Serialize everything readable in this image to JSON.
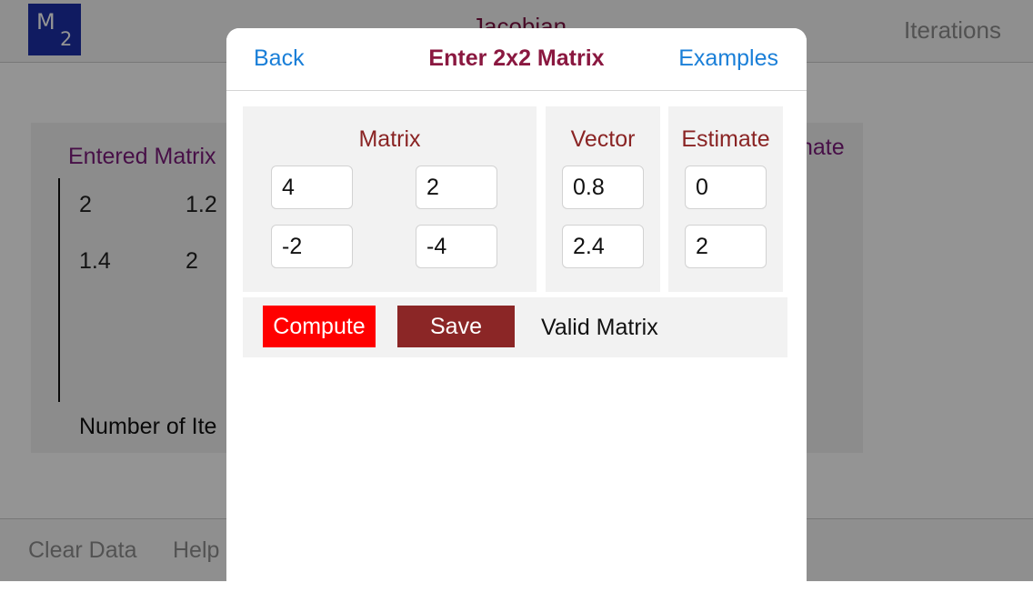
{
  "background": {
    "logo": {
      "letter": "M",
      "subscript": "2"
    },
    "title": "Jacobian",
    "nav_right": "Iterations",
    "panel": {
      "entered_label": "Entered Matrix",
      "estimate_label_partial": "nate",
      "cells": [
        [
          "2",
          "1.2"
        ],
        [
          "1.4",
          "2"
        ]
      ],
      "iterations_label_partial": "Number of Ite"
    },
    "bottom_bar": {
      "clear_label": "Clear Data",
      "help_label_partial": "Help"
    }
  },
  "modal": {
    "back_label": "Back",
    "title": "Enter 2x2 Matrix",
    "examples_label": "Examples",
    "matrix_label": "Matrix",
    "vector_label": "Vector",
    "estimate_label": "Estimate",
    "matrix": [
      [
        "4",
        "2"
      ],
      [
        "-2",
        "-4"
      ]
    ],
    "vector": [
      "0.8",
      "2.4"
    ],
    "estimate": [
      "0",
      "2"
    ],
    "compute_label": "Compute",
    "save_label": "Save",
    "status": "Valid Matrix"
  },
  "colors": {
    "compute_button": "#ff0000",
    "save_button": "#8b2626",
    "link_blue": "#1a7fd8",
    "title_maroon": "#8a1840",
    "logo_blue": "#1c2fa8"
  }
}
